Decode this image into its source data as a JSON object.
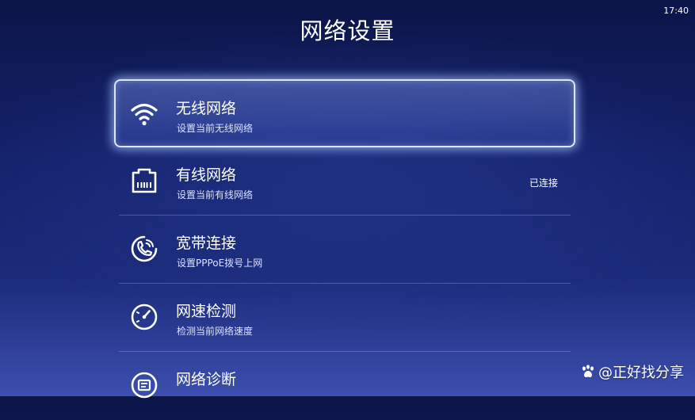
{
  "status_bar": {
    "time": "17:40"
  },
  "header": {
    "title": "网络设置"
  },
  "menu": {
    "items": [
      {
        "title": "无线网络",
        "subtitle": "设置当前无线网络",
        "status": "",
        "icon": "wifi-icon",
        "selected": true
      },
      {
        "title": "有线网络",
        "subtitle": "设置当前有线网络",
        "status": "已连接",
        "icon": "ethernet-port-icon",
        "selected": false
      },
      {
        "title": "宽带连接",
        "subtitle": "设置PPPoE拨号上网",
        "status": "",
        "icon": "phone-dial-icon",
        "selected": false
      },
      {
        "title": "网速检测",
        "subtitle": "检测当前网络速度",
        "status": "",
        "icon": "speedometer-icon",
        "selected": false
      },
      {
        "title": "网络诊断",
        "subtitle": "",
        "status": "",
        "icon": "diagnosis-icon",
        "selected": false
      }
    ]
  },
  "watermark": {
    "text": "@正好找分享",
    "icon": "paw-icon"
  },
  "colors": {
    "background_top": "#0c1548",
    "background_bottom": "#3d4fae",
    "selection_border": "#dfe6ff",
    "text": "#ffffff"
  }
}
